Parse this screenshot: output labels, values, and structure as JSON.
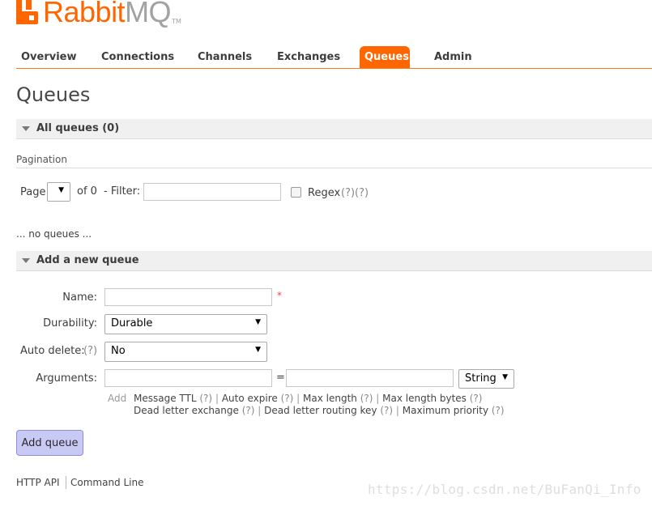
{
  "logo": {
    "rabbit": "Rabbit",
    "mq": "MQ",
    "tm": "TM"
  },
  "nav": {
    "tabs": [
      {
        "label": "Overview"
      },
      {
        "label": "Connections"
      },
      {
        "label": "Channels"
      },
      {
        "label": "Exchanges"
      },
      {
        "label": "Queues",
        "active": true
      },
      {
        "label": "Admin"
      }
    ]
  },
  "page_title": "Queues",
  "all_queues": {
    "title": "All queues (0)"
  },
  "pagination": {
    "section_label": "Pagination",
    "page_label": "Page",
    "page_value": "",
    "of_text": "of 0",
    "filter_label": "- Filter:",
    "filter_value": "",
    "regex_label": "Regex",
    "regex_help": "(?)(?)"
  },
  "empty_text": "... no queues ...",
  "add_queue": {
    "title": "Add a new queue",
    "name_label": "Name:",
    "name_value": "",
    "required_mark": "*",
    "durability_label": "Durability:",
    "durability_value": "Durable",
    "auto_delete_label": "Auto delete:",
    "auto_delete_help": "(?)",
    "auto_delete_value": "No",
    "arguments_label": "Arguments:",
    "arg_key": "",
    "equals": "=",
    "arg_value": "",
    "arg_type": "String",
    "add_label": "Add",
    "arg_links_row1": [
      {
        "label": "Message TTL",
        "help": "(?)"
      },
      {
        "label": "Auto expire",
        "help": "(?)"
      },
      {
        "label": "Max length",
        "help": "(?)"
      },
      {
        "label": "Max length bytes",
        "help": "(?)"
      }
    ],
    "arg_links_row2": [
      {
        "label": "Dead letter exchange",
        "help": "(?)"
      },
      {
        "label": "Dead letter routing key",
        "help": "(?)"
      },
      {
        "label": "Maximum priority",
        "help": "(?)"
      }
    ],
    "separator": "|",
    "submit_label": "Add queue"
  },
  "footer": {
    "http_api": "HTTP API",
    "command_line": "Command Line"
  },
  "watermark": "https://blog.csdn.net/BuFanQi_Info"
}
